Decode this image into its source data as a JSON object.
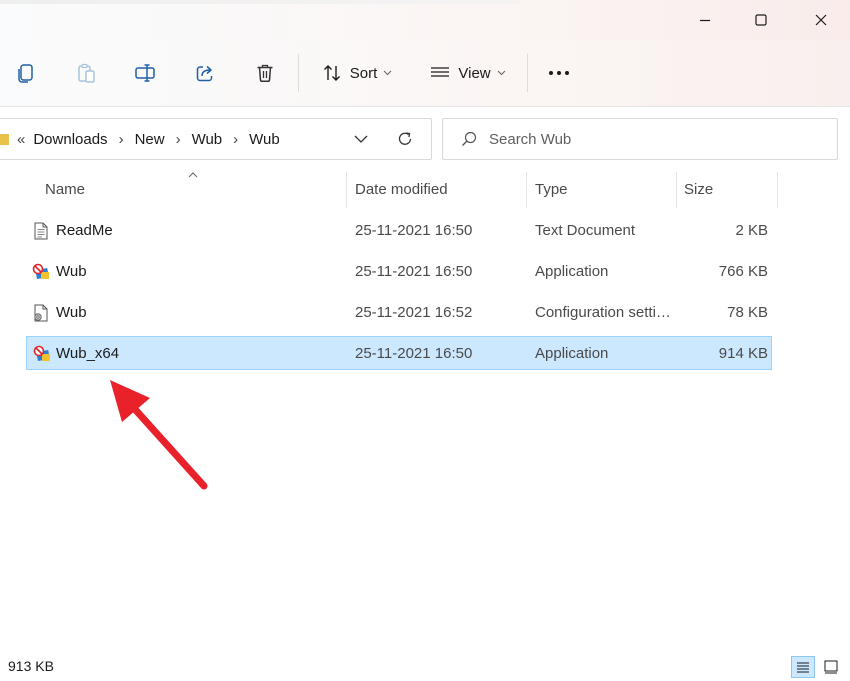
{
  "window": {
    "minimize_icon": "minimize-icon",
    "maximize_icon": "maximize-icon",
    "close_icon": "close-icon"
  },
  "toolbar": {
    "sort_label": "Sort",
    "view_label": "View",
    "icons": [
      "copy-icon",
      "paste-icon",
      "rename-icon",
      "share-icon",
      "delete-icon",
      "more-icon"
    ]
  },
  "address": {
    "overflow": "«",
    "crumbs": [
      "Downloads",
      "New",
      "Wub",
      "Wub"
    ],
    "separator": "›"
  },
  "search": {
    "placeholder": "Search Wub"
  },
  "columns": {
    "name": "Name",
    "date": "Date modified",
    "type": "Type",
    "size": "Size"
  },
  "files": [
    {
      "name": "ReadMe",
      "date": "25-11-2021 16:50",
      "type": "Text Document",
      "size": "2 KB",
      "icon": "text-document-icon",
      "selected": false
    },
    {
      "name": "Wub",
      "date": "25-11-2021 16:50",
      "type": "Application",
      "size": "766 KB",
      "icon": "application-icon",
      "selected": false
    },
    {
      "name": "Wub",
      "date": "25-11-2021 16:52",
      "type": "Configuration setti…",
      "size": "78 KB",
      "icon": "config-settings-icon",
      "selected": false
    },
    {
      "name": "Wub_x64",
      "date": "25-11-2021 16:50",
      "type": "Application",
      "size": "914 KB",
      "icon": "application-icon",
      "selected": true
    }
  ],
  "status": {
    "selection_size": "913 KB"
  },
  "colors": {
    "selection_bg": "#cce8ff",
    "selection_border": "#99d1ff",
    "annotation_arrow": "#e8212b"
  }
}
